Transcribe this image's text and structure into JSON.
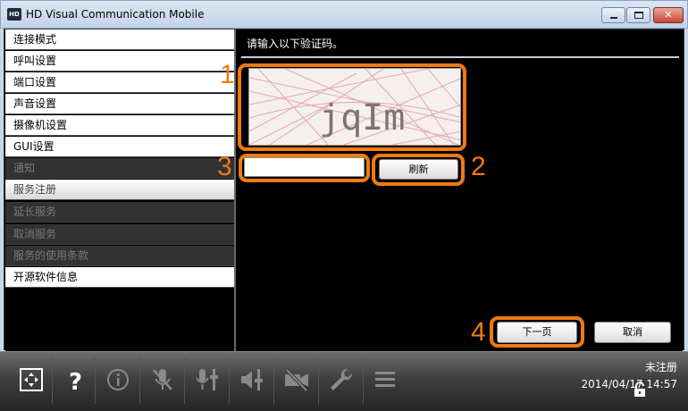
{
  "window": {
    "title": "HD Visual Communication Mobile",
    "icon_label": "HD"
  },
  "sidebar": {
    "items": [
      {
        "label": "连接模式",
        "state": "normal"
      },
      {
        "label": "呼叫设置",
        "state": "normal"
      },
      {
        "label": "端口设置",
        "state": "normal"
      },
      {
        "label": "声音设置",
        "state": "normal"
      },
      {
        "label": "摄像机设置",
        "state": "normal"
      },
      {
        "label": "GUI设置",
        "state": "normal"
      },
      {
        "label": "通知",
        "state": "disabled"
      },
      {
        "label": "服务注册",
        "state": "selected"
      },
      {
        "label": "延长服务",
        "state": "disabled"
      },
      {
        "label": "取消服务",
        "state": "disabled"
      },
      {
        "label": "服务的使用条款",
        "state": "disabled"
      },
      {
        "label": "开源软件信息",
        "state": "normal"
      }
    ]
  },
  "content": {
    "prompt": "请输入以下验证码。",
    "captcha_text": "jqIm",
    "code_input_value": "",
    "refresh_label": "刷新",
    "next_label": "下一页",
    "cancel_label": "取消"
  },
  "callouts": [
    "1",
    "2",
    "3",
    "4"
  ],
  "toolbar": {
    "icons": [
      "fit-screen-icon",
      "help-icon",
      "info-icon",
      "mic-mute-icon",
      "mic-volume-icon",
      "speaker-volume-icon",
      "camera-off-icon",
      "settings-wrench-icon",
      "menu-icon"
    ],
    "registration_status": "未注册",
    "datetime": "2014/04/17 14:57"
  },
  "colors": {
    "highlight": "#f07a10",
    "background": "#000000",
    "titlebar": "#c9d6e6"
  }
}
